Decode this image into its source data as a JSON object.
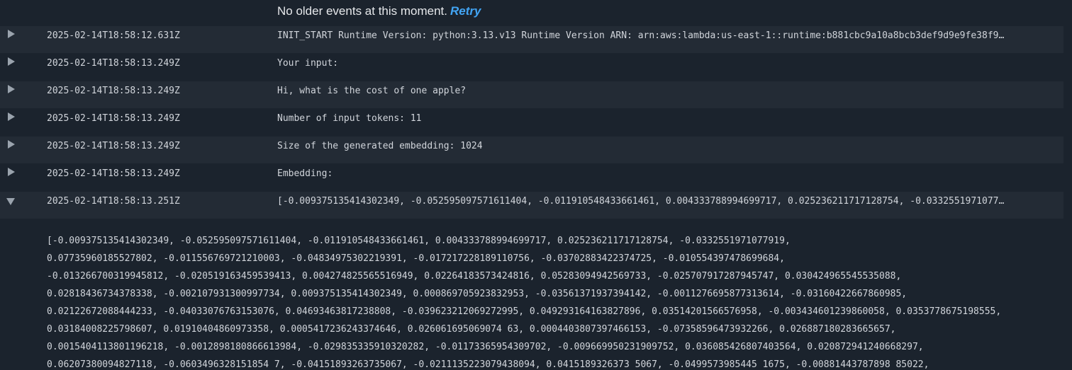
{
  "notice": {
    "text": "No older events at this moment.",
    "retry": "Retry"
  },
  "events": [
    {
      "timestamp": "2025-02-14T18:58:12.631Z",
      "message": "INIT_START Runtime Version: python:3.13.v13 Runtime Version ARN: arn:aws:lambda:us-east-1::runtime:b881cbc9a10a8bcb3def9d9e9fe38f9…",
      "expanded": false
    },
    {
      "timestamp": "2025-02-14T18:58:13.249Z",
      "message": "Your input:",
      "expanded": false
    },
    {
      "timestamp": "2025-02-14T18:58:13.249Z",
      "message": "Hi, what is the cost of one apple?",
      "expanded": false
    },
    {
      "timestamp": "2025-02-14T18:58:13.249Z",
      "message": "Number of input tokens: 11",
      "expanded": false
    },
    {
      "timestamp": "2025-02-14T18:58:13.249Z",
      "message": "Size of the generated embedding: 1024",
      "expanded": false
    },
    {
      "timestamp": "2025-02-14T18:58:13.249Z",
      "message": "Embedding:",
      "expanded": false
    },
    {
      "timestamp": "2025-02-14T18:58:13.251Z",
      "message": "[-0.009375135414302349, -0.052595097571611404, -0.011910548433661461, 0.004333788994699717, 0.025236211717128754, -0.0332551971077…",
      "expanded": true
    }
  ],
  "expanded_lines": [
    "[-0.009375135414302349, -0.052595097571611404, -0.011910548433661461, 0.004333788994699717, 0.025236211717128754, -0.0332551971077919,",
    "0.07735960185527802, -0.011556769721210003, -0.04834975302219391, -0.017217228189110756, -0.03702883422374725, -0.010554397478699684,",
    "-0.013266700319945812, -0.020519163459539413, 0.004274825565516949, 0.02264183573424816, 0.05283094942569733, -0.025707917287945747, 0.030424965545535088,",
    "0.02818436734378338, -0.002107931300997734, 0.009375135414302349, 0.000869705923832953, -0.03561371937394142, -0.0011276695877313614, -0.03160422667860985,",
    "0.02122672088444233, -0.04033076763153076, 0.04693463817238808, -0.039623212069272995, 0.049293164163827896, 0.03514201566576958, -0.003434601239860058, 0.0353778675198555,",
    "0.03184008225798607, 0.01910404860973358, 0.0005417236243374646, 0.026061695069074 63, 0.0004403807397466153, -0.07358596473932266, 0.026887180283665657,",
    "0.0015404113801196218, -0.0012898180866613984, -0.029835335910320282, -0.01173365954309702, -0.009669950231909752, 0.036085426807403564, 0.020872941240668297,",
    "0.06207380094827118, -0.0603496328151854 7, -0.04151893263735067, -0.0211135223079438094, 0.0415189326373 5067, -0.0499573985445 1675, -0.00881443787898 85022,"
  ]
}
